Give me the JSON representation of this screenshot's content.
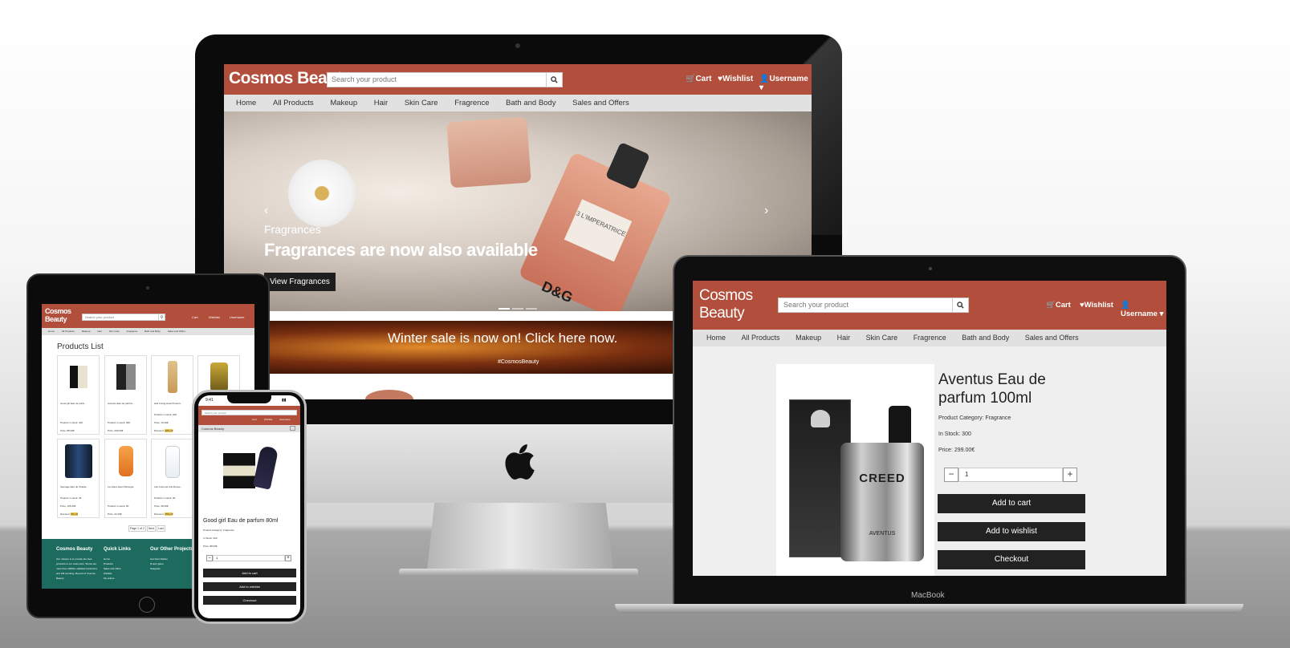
{
  "site": {
    "brand": "Cosmos Beauty",
    "brand_line1": "Cosmos",
    "brand_line2": "Beauty",
    "search_placeholder": "Search your product",
    "cart": "Cart",
    "wishlist": "Wishlist",
    "username": "Username",
    "nav": [
      "Home",
      "All Products",
      "Makeup",
      "Hair",
      "Skin Care",
      "Fragrence",
      "Bath and Body",
      "Sales and Offers"
    ]
  },
  "desktop": {
    "hero_subtitle": "Fragrances",
    "hero_title": "Fragrances are now also available",
    "hero_button": "View Fragrances",
    "sale_title": "Winter sale is now on! Click here now.",
    "sale_tag": "#CosmosBeauty",
    "bottle_label": "3 L'IMPERATRICE",
    "bottle_brand": "D&G"
  },
  "laptop": {
    "product_title": "Aventus Eau de parfum 100ml",
    "category": "Product Category: Fragrance",
    "stock": "In Stock: 300",
    "price": "Price: 299.00€",
    "qty": "1",
    "add_to_cart": "Add to cart",
    "add_to_wishlist": "Add to wishlist",
    "checkout": "Checkout",
    "device_label": "MacBook",
    "bottle_brand": "CREED",
    "bottle_name": "AVENTUS"
  },
  "tablet": {
    "list_title": "Products List",
    "products": [
      {
        "name": "Good girl Eau de parfu...",
        "stock": "Product in stock: 400",
        "price": "Price: 88.00€",
        "discount": ""
      },
      {
        "name": "Aventus Eau de parfum ...",
        "stock": "Product in stock: 300",
        "price": "Price: 299.00€",
        "discount": ""
      },
      {
        "name": "Hair Fixing Heat Protecti...",
        "stock": "Product in stock: 200",
        "price": "Price: 16.00€",
        "discount": "10% off"
      },
      {
        "name": "",
        "stock": "",
        "price": "",
        "discount": ""
      },
      {
        "name": "Sauvage Eau de Toilette...",
        "stock": "Product in stock: 45",
        "price": "Price: 105.00€",
        "discount": "5% off"
      },
      {
        "name": "Les Eaux Eau D'Energie",
        "stock": "Product in stock: 50",
        "price": "Price: 22.00€",
        "discount": ""
      },
      {
        "name": "Lait Corporel Anti-Desse...",
        "stock": "Product in stock: 30",
        "price": "Price: 38.00€",
        "discount": "15% off"
      }
    ],
    "pagination": [
      "Page 1 of 2",
      "Next",
      "Last"
    ],
    "footer": {
      "col1_title": "Cosmos Beauty",
      "col1_text": "Our mission is to provide the best products to our customers. Stores are more than 10000+ satisfied customers and still counting. Be part of Cosmos Beauty.",
      "col2_title": "Quick Links",
      "col2_links": [
        "Home",
        "Products",
        "Sales and offers",
        "Wishlist",
        "My orders"
      ],
      "col3_title": "Our Other Projects",
      "col3_links": [
        "Get Next Station",
        "Ill quiz game",
        "Seagrass"
      ]
    }
  },
  "phone": {
    "time": "9:41",
    "brand": "Cosmos Beauty",
    "product_title": "Good girl Eau de parfum 80ml",
    "category": "Product Category: Fragrance",
    "stock": "In Stock: 400",
    "price": "Price: 88.00€",
    "qty": "1",
    "add_to_cart": "Add to cart",
    "add_to_wishlist": "Add to wishlist",
    "checkout": "Checkout"
  },
  "colors": {
    "header": "#b14f3c",
    "nav": "#e1e1e1",
    "button": "#222222",
    "footer": "#1d6b5e",
    "discount": "#f2c84b"
  }
}
